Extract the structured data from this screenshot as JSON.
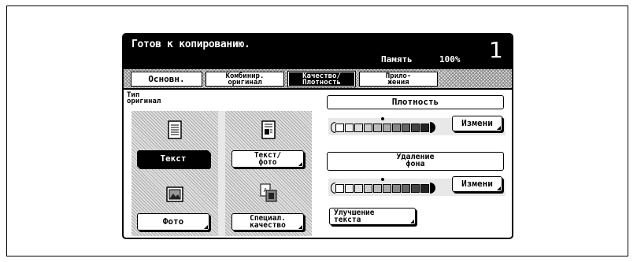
{
  "header": {
    "status": "Готов к копированию.",
    "memory_label": "Память",
    "memory_value": "100%",
    "copies": "1"
  },
  "tabs": [
    {
      "label": "Основн."
    },
    {
      "line1": "Комбинир.",
      "line2": "оригинал"
    },
    {
      "line1": "Качество/",
      "line2": "Плотность"
    },
    {
      "line1": "Прило-",
      "line2": "жения"
    }
  ],
  "original_type": {
    "label_line1": "Тип",
    "label_line2": "оригинал",
    "text": "Текст",
    "text_photo_line1": "Текст/",
    "text_photo_line2": "фото",
    "photo": "Фото",
    "special_line1": "Специал.",
    "special_line2": "качество"
  },
  "density": {
    "title": "Плотность",
    "change": "Измени",
    "level": 0.5
  },
  "background_removal": {
    "title_line1": "Удаление",
    "title_line2": "фона",
    "change": "Измени",
    "level": 0.5
  },
  "text_enhance": {
    "line1": "Улучшение",
    "line2": "текста"
  },
  "scale_cells": [
    "#ffffff",
    "#eeeeee",
    "#dddddd",
    "#cccccc",
    "#bbbbbb",
    "#aaaaaa",
    "#888888",
    "#666666",
    "#444444",
    "#222222"
  ]
}
